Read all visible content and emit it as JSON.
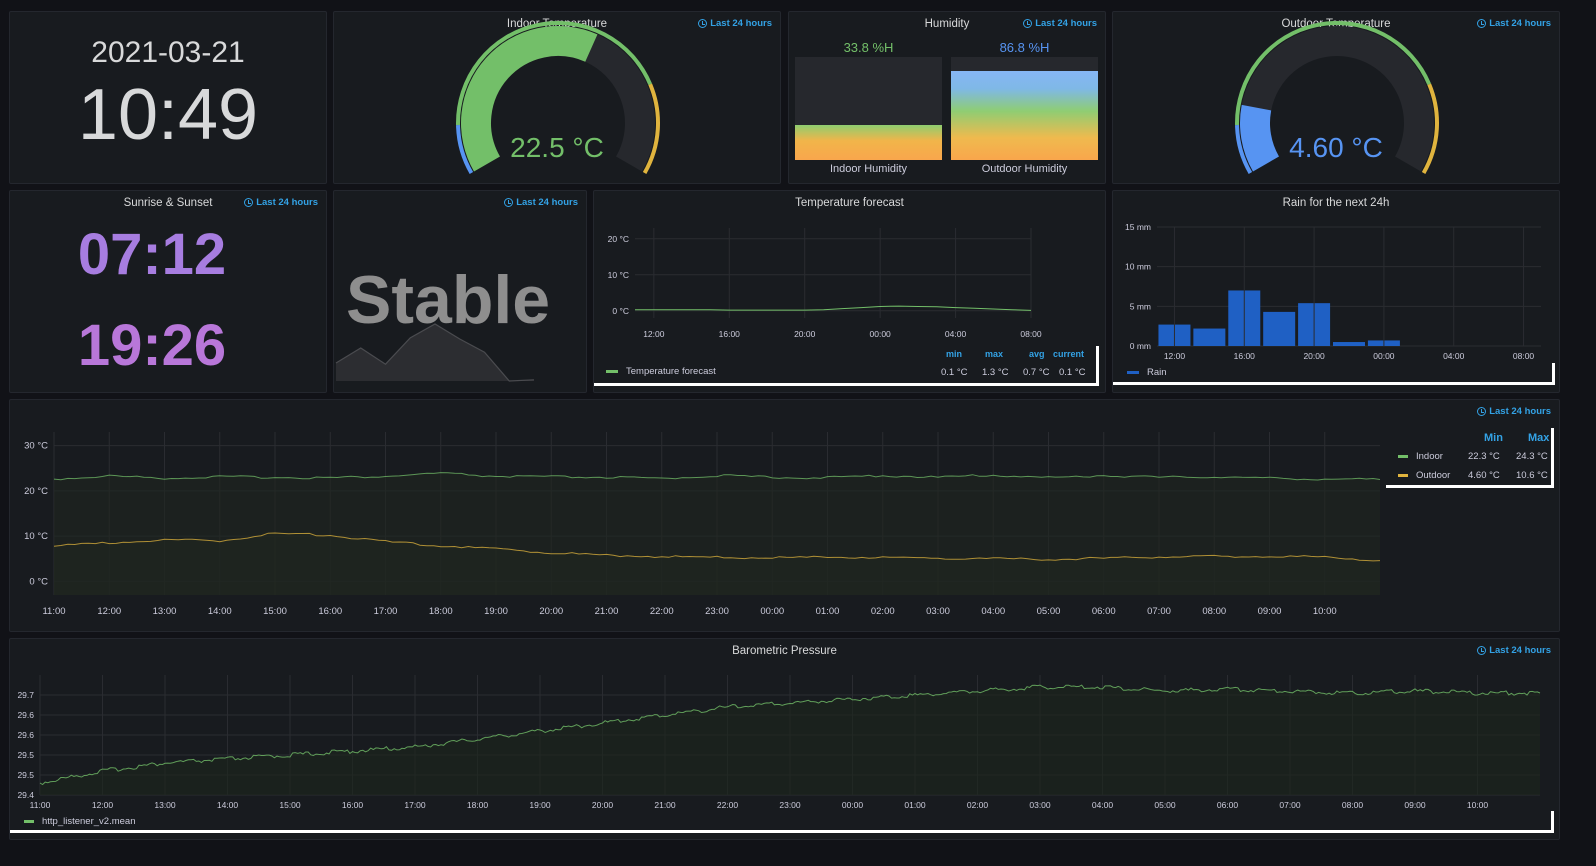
{
  "colors": {
    "green": "#73bf69",
    "yellow": "#e0b43e",
    "blue": "#5794f2",
    "purple": "#a77de0",
    "rainbar": "#1f60c4",
    "link": "#33a2e5"
  },
  "time_range": "Last 24 hours",
  "clock": {
    "date": "2021-03-21",
    "time": "10:49"
  },
  "indoor_temp": {
    "title": "Indoor Temperature",
    "value": "22.5 °C",
    "fraction": 0.6
  },
  "humidity": {
    "title": "Humidity",
    "bars": [
      {
        "label": "Indoor Humidity",
        "value": "33.8 %H",
        "percent": 33.8
      },
      {
        "label": "Outdoor Humidity",
        "value": "86.8 %H",
        "percent": 86.8
      }
    ]
  },
  "outdoor_temp": {
    "title": "Outdoor Temperature",
    "value": "4.60 °C",
    "fraction": 0.17
  },
  "sun": {
    "title": "Sunrise & Sunset",
    "sunrise": "07:12",
    "sunset": "19:26"
  },
  "trend": {
    "value": "Stable",
    "sparkline": [
      0.3,
      0.55,
      0.28,
      0.72,
      0.95,
      0.7,
      0.48,
      0.0,
      0.02
    ]
  },
  "chart_data": [
    {
      "type": "line",
      "title": "Temperature forecast",
      "x": [
        "11:00",
        "12:00",
        "13:00",
        "14:00",
        "15:00",
        "16:00",
        "17:00",
        "18:00",
        "19:00",
        "20:00",
        "21:00",
        "22:00",
        "23:00",
        "00:00",
        "01:00",
        "02:00",
        "03:00",
        "04:00",
        "05:00",
        "06:00",
        "07:00",
        "08:00"
      ],
      "xticks": [
        "12:00",
        "16:00",
        "20:00",
        "00:00",
        "04:00",
        "08:00"
      ],
      "yticks": [
        "0 °C",
        "10 °C",
        "20 °C"
      ],
      "ylim": [
        -2,
        23
      ],
      "series": [
        {
          "name": "Temperature forecast",
          "values": [
            0.3,
            0.3,
            0.3,
            0.3,
            0.3,
            0.2,
            0.2,
            0.2,
            0.2,
            0.2,
            0.3,
            0.6,
            0.9,
            1.2,
            1.3,
            1.2,
            1.1,
            0.9,
            0.7,
            0.5,
            0.3,
            0.1
          ]
        }
      ],
      "legend_headers": [
        "min",
        "max",
        "avg",
        "current"
      ],
      "legend_values": [
        "0.1 °C",
        "1.3 °C",
        "0.7 °C",
        "0.1 °C"
      ]
    },
    {
      "type": "bar",
      "title": "Rain for the next 24h",
      "categories": [
        "12:00",
        "14:00",
        "16:00",
        "18:00",
        "20:00",
        "22:00",
        "00:00",
        "02:00",
        "04:00",
        "06:00",
        "08:00"
      ],
      "xticks": [
        "12:00",
        "16:00",
        "20:00",
        "00:00",
        "04:00",
        "08:00"
      ],
      "yticks": [
        "0 mm",
        "5 mm",
        "10 mm",
        "15 mm"
      ],
      "ylim": [
        0,
        15
      ],
      "values": [
        2.7,
        2.2,
        7.0,
        4.3,
        5.4,
        0.5,
        0.7,
        0,
        0,
        0,
        0
      ],
      "series_name": "Rain"
    },
    {
      "type": "line",
      "x": [
        "11:00",
        "12:00",
        "13:00",
        "14:00",
        "15:00",
        "16:00",
        "17:00",
        "18:00",
        "19:00",
        "20:00",
        "21:00",
        "22:00",
        "23:00",
        "00:00",
        "01:00",
        "02:00",
        "03:00",
        "04:00",
        "05:00",
        "06:00",
        "07:00",
        "08:00",
        "09:00",
        "10:00",
        "10:49"
      ],
      "xticks": [
        "11:00",
        "12:00",
        "13:00",
        "14:00",
        "15:00",
        "16:00",
        "17:00",
        "18:00",
        "19:00",
        "20:00",
        "21:00",
        "22:00",
        "23:00",
        "00:00",
        "01:00",
        "02:00",
        "03:00",
        "04:00",
        "05:00",
        "06:00",
        "07:00",
        "08:00",
        "09:00",
        "10:00"
      ],
      "yticks": [
        "0 °C",
        "10 °C",
        "20 °C",
        "30 °C"
      ],
      "ylim": [
        -3,
        33
      ],
      "series": [
        {
          "name": "Indoor",
          "min": "22.3 °C",
          "max": "24.3 °C",
          "values": [
            22.6,
            23.3,
            22.8,
            23.1,
            23.0,
            22.9,
            23.2,
            23.9,
            23.2,
            23.1,
            23.0,
            22.7,
            23.4,
            23.0,
            22.9,
            23.4,
            23.0,
            23.5,
            22.9,
            23.4,
            23.0,
            23.1,
            22.8,
            22.6,
            22.5
          ]
        },
        {
          "name": "Outdoor",
          "min": "4.60 °C",
          "max": "10.6 °C",
          "values": [
            7.8,
            8.5,
            9.2,
            9.0,
            10.6,
            10.2,
            8.8,
            7.9,
            7.2,
            6.3,
            5.8,
            5.5,
            5.3,
            5.2,
            5.4,
            5.3,
            5.2,
            5.0,
            4.9,
            5.1,
            5.4,
            5.5,
            5.6,
            5.4,
            4.6
          ]
        }
      ],
      "legend_headers": [
        "Min",
        "Max"
      ]
    },
    {
      "type": "line",
      "title": "Barometric Pressure",
      "x": [
        "11:00",
        "12:00",
        "13:00",
        "14:00",
        "15:00",
        "16:00",
        "17:00",
        "18:00",
        "19:00",
        "20:00",
        "21:00",
        "22:00",
        "23:00",
        "00:00",
        "01:00",
        "02:00",
        "03:00",
        "04:00",
        "05:00",
        "06:00",
        "07:00",
        "08:00",
        "09:00",
        "10:00",
        "10:49"
      ],
      "xticks": [
        "11:00",
        "12:00",
        "13:00",
        "14:00",
        "15:00",
        "16:00",
        "17:00",
        "18:00",
        "19:00",
        "20:00",
        "21:00",
        "22:00",
        "23:00",
        "00:00",
        "01:00",
        "02:00",
        "03:00",
        "04:00",
        "05:00",
        "06:00",
        "07:00",
        "08:00",
        "09:00",
        "10:00"
      ],
      "yticks": [
        "29.4",
        "29.5",
        "29.5",
        "29.6",
        "29.6",
        "29.7"
      ],
      "ylim": [
        29.4,
        29.7
      ],
      "series": [
        {
          "name": "http_listener_v2.mean",
          "values": [
            29.43,
            29.46,
            29.48,
            29.49,
            29.5,
            29.51,
            29.52,
            29.54,
            29.56,
            29.58,
            29.6,
            29.62,
            29.63,
            29.64,
            29.65,
            29.66,
            29.67,
            29.67,
            29.66,
            29.665,
            29.66,
            29.655,
            29.66,
            29.655,
            29.655
          ]
        }
      ]
    }
  ]
}
